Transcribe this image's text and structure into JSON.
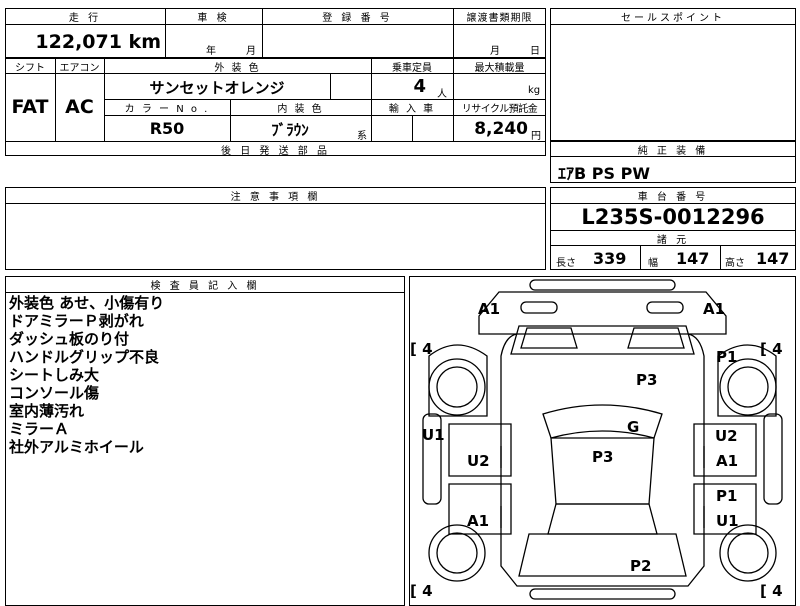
{
  "header": {
    "mileage_label": "走 行",
    "inspection_label": "車 検",
    "registration_label": "登 録 番 号",
    "transfer_label": "譲渡書類期限",
    "selling_points_label": "セールスポイント",
    "mileage_value": "122,071 km",
    "year_label": "年",
    "month_label": "月",
    "transfer_month_label": "月",
    "transfer_day_label": "日"
  },
  "specs": {
    "shift_label": "シフト",
    "aircon_label": "エアコン",
    "exterior_color_label": "外 装 色",
    "capacity_label": "乗車定員",
    "max_load_label": "最大積載量",
    "shift_value": "FAT",
    "aircon_value": "AC",
    "exterior_color_value": "サンセットオレンジ",
    "capacity_value": "4",
    "capacity_unit": "人",
    "max_load_unit": "kg",
    "color_no_label": "カ ラ ー N o .",
    "interior_color_label": "内 装 色",
    "import_label": "輸 入 車",
    "recycle_label": "リサイクル預託金",
    "color_no_value": "R50",
    "interior_color_value": "ﾌﾞﾗｳﾝ",
    "interior_suffix": "系",
    "recycle_value": "8,240",
    "recycle_unit": "円",
    "later_parts_label": "後 日 発 送 部 品"
  },
  "equipment": {
    "label": "純 正 装 備",
    "value": "ｴｱB PS PW"
  },
  "caution": {
    "label": "注 意 事 項 欄"
  },
  "chassis": {
    "label": "車 台 番 号",
    "value": "L235S-0012296",
    "dims_label": "諸 元",
    "length_label": "長さ",
    "length_value": "339",
    "width_label": "幅",
    "width_value": "147",
    "height_label": "高さ",
    "height_value": "147"
  },
  "inspector": {
    "label": "検 査 員 記 入 欄",
    "notes": [
      "外装色 あせ、小傷有り",
      "ドアミラーＰ剥がれ",
      "ダッシュ板のり付",
      "ハンドルグリップ不良",
      "シートしみ大",
      "コンソール傷",
      "室内薄汚れ",
      "ミラーＡ",
      "社外アルミホイール"
    ]
  },
  "diagram": {
    "a1_top_left": "A1",
    "a1_top_right": "A1",
    "tire_fl": "4",
    "tire_fr": "4",
    "tire_rl": "4",
    "tire_rr": "4",
    "p1_front_right": "P1",
    "p3_hood": "P3",
    "u1_left": "U1",
    "g_windshield": "G",
    "u2_right": "U2",
    "u2_left_door": "U2",
    "p3_roof": "P3",
    "a1_right_door": "A1",
    "p1_right_rear": "P1",
    "a1_left_rear": "A1",
    "u1_right_rear": "U1",
    "p2_rear": "P2"
  }
}
